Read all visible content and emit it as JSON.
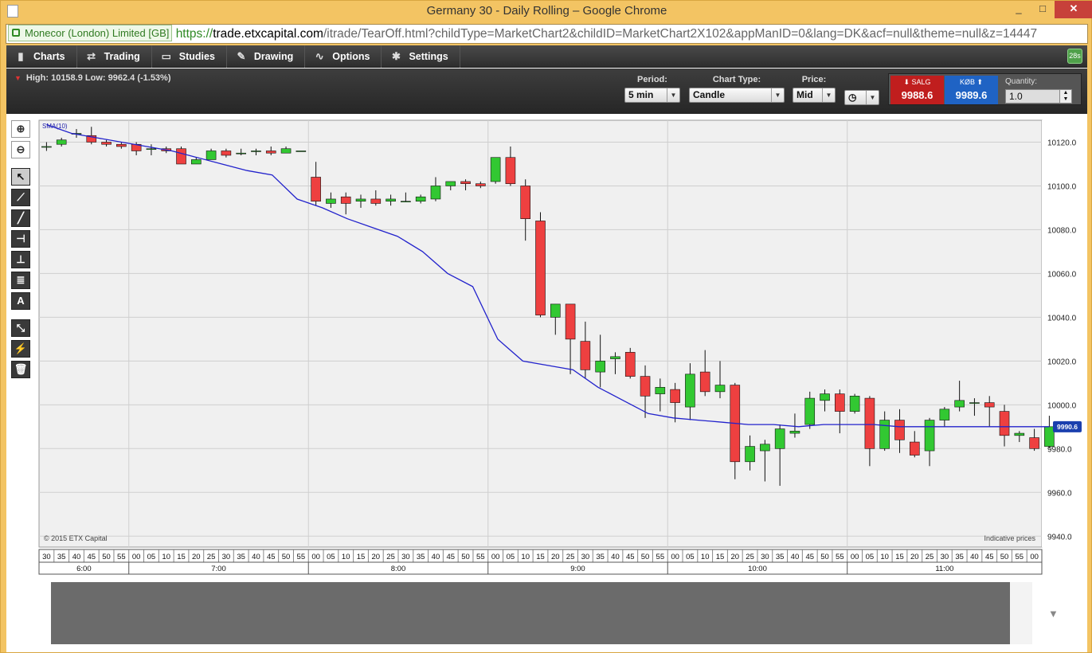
{
  "window": {
    "title": "Germany 30 - Daily Rolling – Google Chrome",
    "controls": [
      "_",
      "□",
      "✕"
    ]
  },
  "address": {
    "cert": "Monecor (London)  Limited [GB]",
    "scheme": "https://",
    "host": "trade.etxcapital.com",
    "path": "/itrade/TearOff.html?childType=MarketChart2&childID=MarketChart2X102&appManID=0&lang=DK&acf=null&theme=null&z=14447"
  },
  "toolbar": {
    "items": [
      {
        "label": "Charts",
        "icon": "bar-chart-icon"
      },
      {
        "label": "Trading",
        "icon": "trading-icon"
      },
      {
        "label": "Studies",
        "icon": "studies-icon"
      },
      {
        "label": "Drawing",
        "icon": "pencil-icon"
      },
      {
        "label": "Options",
        "icon": "options-icon"
      },
      {
        "label": "Settings",
        "icon": "gear-icon"
      }
    ],
    "timer": "28s"
  },
  "info": {
    "high_low": "High: 10158.9 Low: 9962.4 (-1.53%)",
    "period_label": "Period:",
    "period": "5 min",
    "chart_type_label": "Chart Type:",
    "chart_type": "Candle",
    "price_label": "Price:",
    "price": "Mid",
    "sell_label": "SALG",
    "sell_price": "9988.6",
    "buy_label": "KØB",
    "buy_price": "9989.6",
    "quantity_label": "Quantity:",
    "quantity": "1.0"
  },
  "chart": {
    "indicator": "SMA(10)",
    "copyright": "© 2015 ETX Capital",
    "indicative": "Indicative prices",
    "price_tag": "9990.6",
    "y_ticks": [
      10120,
      10100,
      10080,
      10060,
      10040,
      10020,
      10000,
      9980,
      9960,
      9940
    ],
    "y_tick_labels": [
      "10120.0",
      "10100.0",
      "10080.0",
      "10060.0",
      "10040.0",
      "10020.0",
      "10000.0",
      "9980.0",
      "9960.0",
      "9940.0"
    ],
    "minute_labels": [
      "30",
      "35",
      "40",
      "45",
      "50",
      "55",
      "00",
      "05",
      "10",
      "15",
      "20",
      "25",
      "30",
      "35",
      "40",
      "45",
      "50",
      "55",
      "00",
      "05",
      "10",
      "15",
      "20",
      "25",
      "30",
      "35",
      "40",
      "45",
      "50",
      "55",
      "00",
      "05",
      "10",
      "15",
      "20",
      "25",
      "30",
      "35",
      "40",
      "45",
      "50",
      "55",
      "00",
      "05",
      "10",
      "15",
      "20",
      "25",
      "30",
      "35",
      "40",
      "45",
      "50",
      "55",
      "00",
      "05",
      "10",
      "15",
      "20",
      "25",
      "30",
      "35",
      "40",
      "45",
      "50",
      "55",
      "00"
    ],
    "hour_labels": [
      {
        "label": "6:00",
        "from": 0,
        "to": 6
      },
      {
        "label": "7:00",
        "from": 6,
        "to": 18
      },
      {
        "label": "8:00",
        "from": 18,
        "to": 30
      },
      {
        "label": "9:00",
        "from": 30,
        "to": 42
      },
      {
        "label": "10:00",
        "from": 42,
        "to": 54
      },
      {
        "label": "11:00",
        "from": 54,
        "to": 67
      }
    ]
  },
  "chart_data": {
    "type": "candlestick",
    "ylim": [
      9935,
      10130
    ],
    "candles": [
      [
        10118,
        10120,
        10116,
        10118
      ],
      [
        10119,
        10122,
        10118,
        10121
      ],
      [
        10124,
        10126,
        10122,
        10124
      ],
      [
        10123,
        10127,
        10119,
        10120
      ],
      [
        10120,
        10121,
        10118,
        10119
      ],
      [
        10119,
        10120,
        10117,
        10118
      ],
      [
        10119,
        10120,
        10114,
        10116
      ],
      [
        10117,
        10119,
        10114,
        10117
      ],
      [
        10117,
        10118,
        10115,
        10116
      ],
      [
        10117,
        10118,
        10110,
        10110
      ],
      [
        10110,
        10113,
        10110,
        10112
      ],
      [
        10112,
        10117,
        10112,
        10116
      ],
      [
        10116,
        10117,
        10113,
        10114
      ],
      [
        10115,
        10117,
        10114,
        10115
      ],
      [
        10116,
        10117,
        10114,
        10116
      ],
      [
        10116,
        10118,
        10114,
        10115
      ],
      [
        10115,
        10118,
        10115,
        10117
      ],
      [
        10116,
        10116,
        10116,
        10116
      ],
      [
        10104,
        10111,
        10091,
        10093
      ],
      [
        10092,
        10097,
        10090,
        10094
      ],
      [
        10095,
        10097,
        10087,
        10092
      ],
      [
        10093,
        10096,
        10090,
        10094
      ],
      [
        10094,
        10098,
        10091,
        10092
      ],
      [
        10093,
        10096,
        10091,
        10094
      ],
      [
        10093,
        10097,
        10093,
        10093
      ],
      [
        10093,
        10096,
        10092,
        10095
      ],
      [
        10094,
        10104,
        10093,
        10100
      ],
      [
        10100,
        10102,
        10098,
        10102
      ],
      [
        10102,
        10103,
        10098,
        10101
      ],
      [
        10101,
        10102,
        10099,
        10100
      ],
      [
        10102,
        10113,
        10101,
        10113
      ],
      [
        10113,
        10118,
        10100,
        10101
      ],
      [
        10100,
        10103,
        10075,
        10085
      ],
      [
        10084,
        10088,
        10040,
        10041
      ],
      [
        10040,
        10046,
        10032,
        10046
      ],
      [
        10046,
        10046,
        10014,
        10030
      ],
      [
        10029,
        10038,
        10012,
        10016
      ],
      [
        10015,
        10032,
        10008,
        10020
      ],
      [
        10021,
        10024,
        10014,
        10022
      ],
      [
        10024,
        10026,
        10012,
        10013
      ],
      [
        10013,
        10018,
        9994,
        10004
      ],
      [
        10005,
        10012,
        9997,
        10008
      ],
      [
        10007,
        10010,
        9992,
        10001
      ],
      [
        9999,
        10019,
        9993,
        10014
      ],
      [
        10015,
        10025,
        10004,
        10006
      ],
      [
        10006,
        10020,
        10003,
        10009
      ],
      [
        10009,
        10010,
        9966,
        9974
      ],
      [
        9974,
        9986,
        9970,
        9981
      ],
      [
        9979,
        9984,
        9965,
        9982
      ],
      [
        9980,
        9991,
        9963,
        9989
      ],
      [
        9987,
        9996,
        9985,
        9988
      ],
      [
        9991,
        10006,
        9989,
        10003
      ],
      [
        10002,
        10007,
        9997,
        10005
      ],
      [
        10005,
        10007,
        9987,
        9997
      ],
      [
        9997,
        10005,
        9996,
        10004
      ],
      [
        10003,
        10004,
        9972,
        9980
      ],
      [
        9980,
        9997,
        9979,
        9993
      ],
      [
        9993,
        9998,
        9978,
        9984
      ],
      [
        9983,
        9988,
        9976,
        9977
      ],
      [
        9979,
        9994,
        9972,
        9993
      ],
      [
        9993,
        9999,
        9990,
        9998
      ],
      [
        9999,
        10011,
        9997,
        10002
      ],
      [
        10001,
        10003,
        9995,
        10001
      ],
      [
        10001,
        10004,
        9990,
        9999
      ],
      [
        9997,
        10000,
        9981,
        9986
      ],
      [
        9986,
        9988,
        9983,
        9987
      ],
      [
        9985,
        9989,
        9979,
        9980
      ],
      [
        9981,
        9995,
        9980,
        9990
      ]
    ],
    "sma": [
      10128,
      10124,
      10122,
      10120,
      10118,
      10116,
      10113,
      10110,
      10107,
      10105,
      10094,
      10090,
      10085,
      10081,
      10077,
      10070,
      10060,
      10054,
      10030,
      10020,
      10018,
      10016,
      10008,
      10002,
      9996,
      9994,
      9993,
      9992,
      9991,
      9991,
      9990,
      9991,
      9991,
      9991,
      9990,
      9990,
      9990,
      9990,
      9990,
      9990,
      9990
    ]
  }
}
